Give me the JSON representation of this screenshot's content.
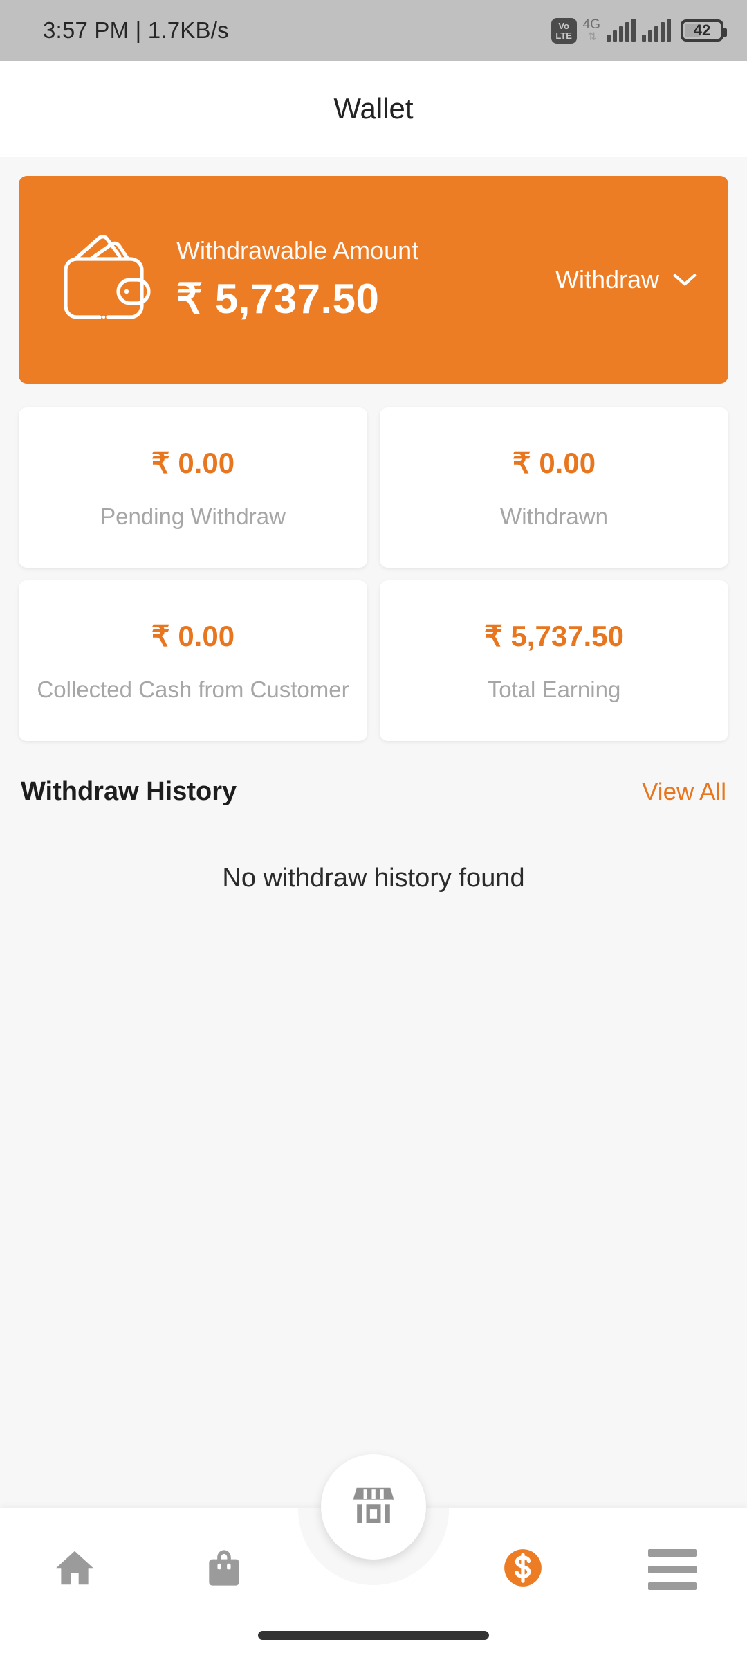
{
  "status_bar": {
    "time_and_network": "3:57 PM | 1.7KB/s",
    "volte_top": "Vo",
    "volte_bottom": "LTE",
    "network_type": "4G",
    "data_arrows": "⇅",
    "battery_level": "42",
    "battery_percent": 42
  },
  "header": {
    "title": "Wallet"
  },
  "wallet_card": {
    "label": "Withdrawable Amount",
    "amount": "₹ 5,737.50",
    "action_label": "Withdraw",
    "chevron": "⌄",
    "background_color": "#ED7D25",
    "icon_name": "wallet-icon"
  },
  "stats": [
    {
      "value": "₹ 0.00",
      "label": "Pending Withdraw"
    },
    {
      "value": "₹ 0.00",
      "label": "Withdrawn"
    },
    {
      "value": "₹ 0.00",
      "label": "Collected Cash from Customer"
    },
    {
      "value": "₹ 5,737.50",
      "label": "Total Earning"
    }
  ],
  "history": {
    "title": "Withdraw History",
    "view_all": "View All",
    "empty_message": "No withdraw history found"
  },
  "bottom_nav": {
    "items": [
      {
        "icon": "home-icon",
        "active": false
      },
      {
        "icon": "shopping-bag-icon",
        "active": false
      },
      {
        "icon": "store-icon",
        "active": false
      },
      {
        "icon": "dollar-coin-icon",
        "active": true
      },
      {
        "icon": "hamburger-menu-icon",
        "active": false
      }
    ],
    "accent_color": "#ED7D25",
    "inactive_color": "#9b9b9b"
  }
}
